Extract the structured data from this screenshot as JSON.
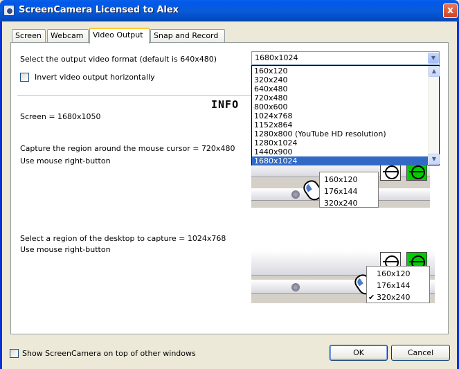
{
  "window": {
    "title": "ScreenCamera Licensed to Alex",
    "close_glyph": "x"
  },
  "tabs": [
    {
      "label": "Screen"
    },
    {
      "label": "Webcam"
    },
    {
      "label": "Video Output",
      "active": true
    },
    {
      "label": "Snap and Record"
    }
  ],
  "output": {
    "format_label": "Select the output video format (default is 640x480)",
    "selected": "1680x1024",
    "options": [
      "160x120",
      "320x240",
      "640x480",
      "720x480",
      "800x600",
      "1024x768",
      "1152x864",
      "1280x800 (YouTube HD resolution)",
      "1280x1024",
      "1440x900",
      "1680x1024"
    ],
    "invert_label": "Invert video output horizontally",
    "invert_checked": false
  },
  "info": {
    "title": "INFO",
    "screen": "Screen = 1680x1050",
    "mouse_region": "Capture the region around the mouse cursor = 720x480",
    "mouse_hint": "Use mouse right-button",
    "desktop_region": "Select a region of the desktop to capture = 1024x768",
    "desktop_hint": "Use mouse right-button",
    "demo1_menu": [
      "160x120",
      "176x144",
      "320x240"
    ],
    "demo2_menu": [
      "160x120",
      "176x144",
      "320x240"
    ],
    "demo2_checked": "320x240",
    "check_glyph": "✔"
  },
  "footer": {
    "ontop_label": "Show ScreenCamera on top of other windows",
    "ok": "OK",
    "cancel": "Cancel"
  },
  "colors": {
    "selection": "#316AC5",
    "titlebar": "#0058EE",
    "accent_green": "#00CC00"
  }
}
